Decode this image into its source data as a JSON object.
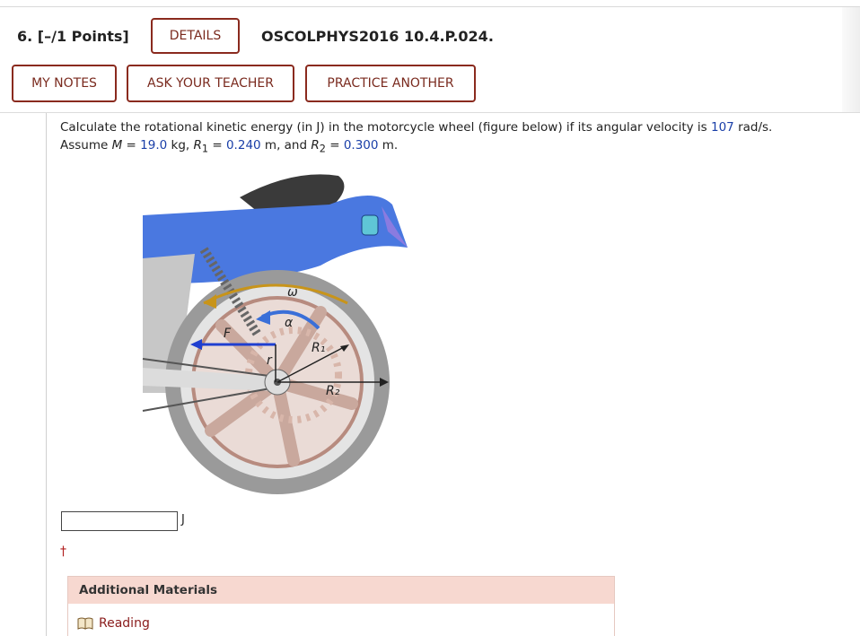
{
  "question": {
    "number_label": "6.  [–/1 Points]",
    "details_label": "DETAILS",
    "id": "OSCOLPHYS2016 10.4.P.024."
  },
  "actions": {
    "my_notes": "MY NOTES",
    "ask_teacher": "ASK YOUR TEACHER",
    "practice_another": "PRACTICE ANOTHER"
  },
  "problem": {
    "line1_a": "Calculate the rotational kinetic energy (in J) in the motorcycle wheel (figure below) if its angular velocity is ",
    "omega_value": "107",
    "line1_b": " rad/s.",
    "assume": "Assume ",
    "M_sym": "M",
    "eq": " = ",
    "M_value": "19.0",
    "M_unit": " kg, ",
    "R1_sym": "R",
    "R1_sub": "1",
    "R1_value": "0.240",
    "R1_unit": " m, and ",
    "R2_sym": "R",
    "R2_sub": "2",
    "R2_value": "0.300",
    "R2_unit": " m."
  },
  "figure": {
    "label_omega": "ω",
    "label_alpha": "α",
    "label_F": "F",
    "label_r": "r",
    "label_R1": "R₁",
    "label_R2": "R₂"
  },
  "answer": {
    "value": "",
    "unit": "J"
  },
  "dagger": "†",
  "additional": {
    "title": "Additional Materials",
    "reading": "Reading"
  },
  "colors": {
    "accent": "#8a2a1e",
    "value_blue": "#1a3fa8",
    "panel": "#f7d8d0"
  }
}
